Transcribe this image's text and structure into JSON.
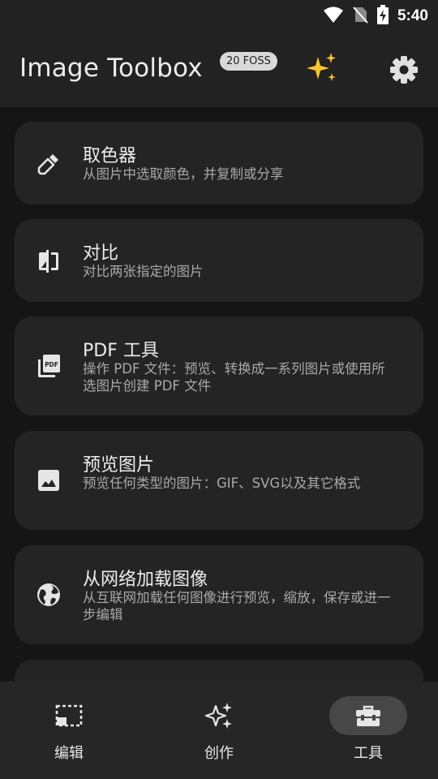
{
  "status_bar": {
    "time": "5:40"
  },
  "header": {
    "title": "Image Toolbox",
    "version_badge": "20 FOSS"
  },
  "tools": [
    {
      "icon": "eyedropper-icon",
      "title": "取色器",
      "description": "从图片中选取颜色，并复制或分享"
    },
    {
      "icon": "compare-icon",
      "title": "对比",
      "description": "对比两张指定的图片"
    },
    {
      "icon": "pdf-icon",
      "title": "PDF 工具",
      "description": "操作 PDF 文件：预览、转换成一系列图片或使用所选图片创建 PDF 文件"
    },
    {
      "icon": "image-icon",
      "title": "预览图片",
      "description": "预览任何类型的图片：GIF、SVG以及其它格式"
    },
    {
      "icon": "globe-icon",
      "title": "从网络加载图像",
      "description": "从互联网加载任何图像进行预览，缩放，保存或进一步编辑"
    },
    {
      "icon": "partial-icon",
      "title": "",
      "description": ""
    }
  ],
  "bottom_nav": {
    "active": "tools",
    "items": [
      {
        "id": "edit",
        "label": "编辑",
        "icon": "crop-frame-icon"
      },
      {
        "id": "create",
        "label": "创作",
        "icon": "sparkles-icon"
      },
      {
        "id": "tools",
        "label": "工具",
        "icon": "toolbox-icon"
      }
    ]
  },
  "colors": {
    "background": "#151515",
    "bar": "#222222",
    "card": "#242424",
    "nav": "#262626",
    "active_pill": "#474747"
  }
}
